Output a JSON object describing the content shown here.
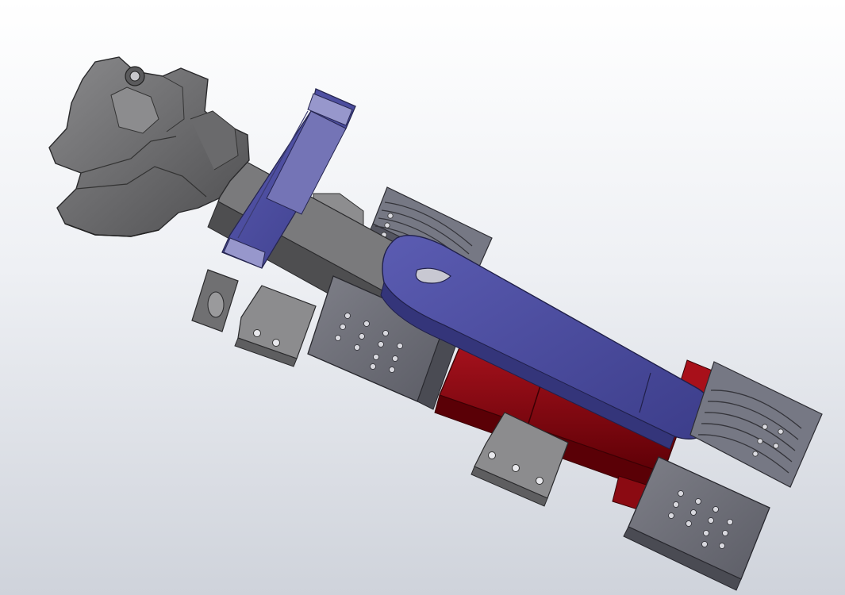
{
  "viewport": {
    "background_top": "#ffffff",
    "background_bottom": "#cfd3db"
  },
  "model": {
    "parts": [
      {
        "name": "gripper-head",
        "color": "#6e6e70"
      },
      {
        "name": "mounting-flange-plate",
        "color": "#7c7cb4"
      },
      {
        "name": "main-body-bar",
        "color": "#727274"
      },
      {
        "name": "slotted-bracket",
        "color": "#8a8a8c"
      },
      {
        "name": "finger-pad-left",
        "color": "#6f7078"
      },
      {
        "name": "finger-pad-right",
        "color": "#6f7078"
      },
      {
        "name": "ribbed-jaw-top",
        "color": "#686a74"
      },
      {
        "name": "ribbed-jaw-bottom",
        "color": "#686a74"
      },
      {
        "name": "pneumatic-cylinder",
        "color": "#8b0a12"
      },
      {
        "name": "lever-arm",
        "color": "#4d4ea0"
      }
    ]
  }
}
